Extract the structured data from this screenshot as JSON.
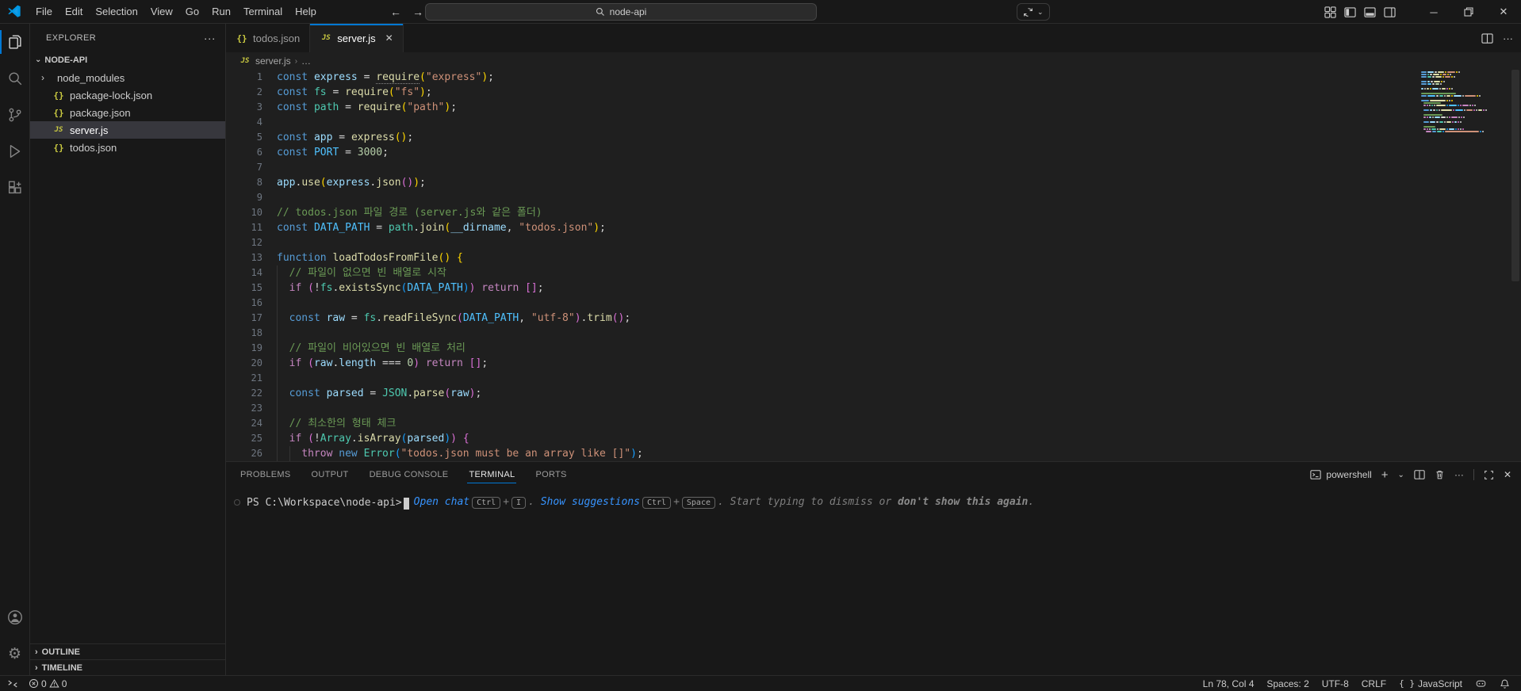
{
  "titlebar": {
    "menus": [
      "File",
      "Edit",
      "Selection",
      "View",
      "Go",
      "Run",
      "Terminal",
      "Help"
    ],
    "search_value": "node-api"
  },
  "explorer": {
    "header": "EXPLORER",
    "root": "NODE-API",
    "files": [
      {
        "name": "node_modules",
        "icon": "folder",
        "selected": false
      },
      {
        "name": "package-lock.json",
        "icon": "json",
        "selected": false
      },
      {
        "name": "package.json",
        "icon": "json",
        "selected": false
      },
      {
        "name": "server.js",
        "icon": "js",
        "selected": true
      },
      {
        "name": "todos.json",
        "icon": "json",
        "selected": false
      }
    ],
    "sections": [
      "OUTLINE",
      "TIMELINE"
    ]
  },
  "tabs": [
    {
      "label": "todos.json",
      "icon": "json",
      "active": false
    },
    {
      "label": "server.js",
      "icon": "js",
      "active": true
    }
  ],
  "breadcrumb": {
    "file": "server.js",
    "tail": "…"
  },
  "syntax_colors": {
    "kw": "#569CD6",
    "ctrl": "#C586C0",
    "var": "#9CDCFE",
    "cn": "#4FC1FF",
    "fn": "#DCDCAA",
    "fnh": "#DCDCAA",
    "cls": "#4EC9B0",
    "str": "#CE9178",
    "num": "#B5CEA8",
    "com": "#6A9955",
    "op": "#D4D4D4",
    "b1": "#FFD700",
    "b2": "#DA70D6",
    "b3": "#179FFF"
  },
  "editor": {
    "lines": [
      [
        [
          "kw",
          "const "
        ],
        [
          "var",
          "express"
        ],
        [
          "op",
          " = "
        ],
        [
          "fnh",
          "require"
        ],
        [
          "b1",
          "("
        ],
        [
          "str",
          "\"express\""
        ],
        [
          "b1",
          ")"
        ],
        [
          "op",
          ";"
        ]
      ],
      [
        [
          "kw",
          "const "
        ],
        [
          "cls",
          "fs"
        ],
        [
          "op",
          " = "
        ],
        [
          "fn",
          "require"
        ],
        [
          "b1",
          "("
        ],
        [
          "str",
          "\"fs\""
        ],
        [
          "b1",
          ")"
        ],
        [
          "op",
          ";"
        ]
      ],
      [
        [
          "kw",
          "const "
        ],
        [
          "cls",
          "path"
        ],
        [
          "op",
          " = "
        ],
        [
          "fn",
          "require"
        ],
        [
          "b1",
          "("
        ],
        [
          "str",
          "\"path\""
        ],
        [
          "b1",
          ")"
        ],
        [
          "op",
          ";"
        ]
      ],
      [],
      [
        [
          "kw",
          "const "
        ],
        [
          "var",
          "app"
        ],
        [
          "op",
          " = "
        ],
        [
          "fn",
          "express"
        ],
        [
          "b1",
          "()"
        ],
        [
          "op",
          ";"
        ]
      ],
      [
        [
          "kw",
          "const "
        ],
        [
          "cn",
          "PORT"
        ],
        [
          "op",
          " = "
        ],
        [
          "num",
          "3000"
        ],
        [
          "op",
          ";"
        ]
      ],
      [],
      [
        [
          "var",
          "app"
        ],
        [
          "op",
          "."
        ],
        [
          "fn",
          "use"
        ],
        [
          "b1",
          "("
        ],
        [
          "var",
          "express"
        ],
        [
          "op",
          "."
        ],
        [
          "fn",
          "json"
        ],
        [
          "b2",
          "()"
        ],
        [
          "b1",
          ")"
        ],
        [
          "op",
          ";"
        ]
      ],
      [],
      [
        [
          "com",
          "// todos.json 파일 경로 (server.js와 같은 폴더)"
        ]
      ],
      [
        [
          "kw",
          "const "
        ],
        [
          "cn",
          "DATA_PATH"
        ],
        [
          "op",
          " = "
        ],
        [
          "cls",
          "path"
        ],
        [
          "op",
          "."
        ],
        [
          "fn",
          "join"
        ],
        [
          "b1",
          "("
        ],
        [
          "var",
          "__dirname"
        ],
        [
          "op",
          ", "
        ],
        [
          "str",
          "\"todos.json\""
        ],
        [
          "b1",
          ")"
        ],
        [
          "op",
          ";"
        ]
      ],
      [],
      [
        [
          "kw",
          "function "
        ],
        [
          "fn",
          "loadTodosFromFile"
        ],
        [
          "b1",
          "()"
        ],
        [
          "op",
          " "
        ],
        [
          "b1",
          "{"
        ]
      ],
      [
        [
          "guide",
          "  "
        ],
        [
          "com",
          "// 파일이 없으면 빈 배열로 시작"
        ]
      ],
      [
        [
          "guide",
          "  "
        ],
        [
          "ctrl",
          "if "
        ],
        [
          "b2",
          "("
        ],
        [
          "op",
          "!"
        ],
        [
          "cls",
          "fs"
        ],
        [
          "op",
          "."
        ],
        [
          "fn",
          "existsSync"
        ],
        [
          "b3",
          "("
        ],
        [
          "cn",
          "DATA_PATH"
        ],
        [
          "b3",
          ")"
        ],
        [
          "b2",
          ")"
        ],
        [
          "ctrl",
          " return"
        ],
        [
          "op",
          " "
        ],
        [
          "b2",
          "[]"
        ],
        [
          "op",
          ";"
        ]
      ],
      [
        [
          "guide",
          "  "
        ]
      ],
      [
        [
          "guide",
          "  "
        ],
        [
          "kw",
          "const "
        ],
        [
          "var",
          "raw"
        ],
        [
          "op",
          " = "
        ],
        [
          "cls",
          "fs"
        ],
        [
          "op",
          "."
        ],
        [
          "fn",
          "readFileSync"
        ],
        [
          "b2",
          "("
        ],
        [
          "cn",
          "DATA_PATH"
        ],
        [
          "op",
          ", "
        ],
        [
          "str",
          "\"utf-8\""
        ],
        [
          "b2",
          ")"
        ],
        [
          "op",
          "."
        ],
        [
          "fn",
          "trim"
        ],
        [
          "b2",
          "()"
        ],
        [
          "op",
          ";"
        ]
      ],
      [
        [
          "guide",
          "  "
        ]
      ],
      [
        [
          "guide",
          "  "
        ],
        [
          "com",
          "// 파일이 비어있으면 빈 배열로 처리"
        ]
      ],
      [
        [
          "guide",
          "  "
        ],
        [
          "ctrl",
          "if "
        ],
        [
          "b2",
          "("
        ],
        [
          "var",
          "raw"
        ],
        [
          "op",
          "."
        ],
        [
          "var",
          "length"
        ],
        [
          "op",
          " === "
        ],
        [
          "num",
          "0"
        ],
        [
          "b2",
          ")"
        ],
        [
          "ctrl",
          " return"
        ],
        [
          "op",
          " "
        ],
        [
          "b2",
          "[]"
        ],
        [
          "op",
          ";"
        ]
      ],
      [
        [
          "guide",
          "  "
        ]
      ],
      [
        [
          "guide",
          "  "
        ],
        [
          "kw",
          "const "
        ],
        [
          "var",
          "parsed"
        ],
        [
          "op",
          " = "
        ],
        [
          "cls",
          "JSON"
        ],
        [
          "op",
          "."
        ],
        [
          "fn",
          "parse"
        ],
        [
          "b2",
          "("
        ],
        [
          "var",
          "raw"
        ],
        [
          "b2",
          ")"
        ],
        [
          "op",
          ";"
        ]
      ],
      [
        [
          "guide",
          "  "
        ]
      ],
      [
        [
          "guide",
          "  "
        ],
        [
          "com",
          "// 최소한의 형태 체크"
        ]
      ],
      [
        [
          "guide",
          "  "
        ],
        [
          "ctrl",
          "if "
        ],
        [
          "b2",
          "("
        ],
        [
          "op",
          "!"
        ],
        [
          "cls",
          "Array"
        ],
        [
          "op",
          "."
        ],
        [
          "fn",
          "isArray"
        ],
        [
          "b3",
          "("
        ],
        [
          "var",
          "parsed"
        ],
        [
          "b3",
          ")"
        ],
        [
          "b2",
          ")"
        ],
        [
          "op",
          " "
        ],
        [
          "b2",
          "{"
        ]
      ],
      [
        [
          "guide",
          "  "
        ],
        [
          "guide",
          "  "
        ],
        [
          "ctrl",
          "throw "
        ],
        [
          "kw",
          "new "
        ],
        [
          "cls",
          "Error"
        ],
        [
          "b3",
          "("
        ],
        [
          "str",
          "\"todos.json must be an array like []\""
        ],
        [
          "b3",
          ")"
        ],
        [
          "op",
          ";"
        ]
      ]
    ]
  },
  "panel": {
    "tabs": [
      {
        "label": "PROBLEMS",
        "active": false
      },
      {
        "label": "OUTPUT",
        "active": false
      },
      {
        "label": "DEBUG CONSOLE",
        "active": false
      },
      {
        "label": "TERMINAL",
        "active": true
      },
      {
        "label": "PORTS",
        "active": false
      }
    ],
    "shell": "powershell"
  },
  "terminal": {
    "prompt": "PS C:\\Workspace\\node-api>",
    "suggest": [
      {
        "t": "link",
        "x": "Open chat"
      },
      {
        "t": "key",
        "x": "Ctrl"
      },
      {
        "t": "plus",
        "x": "+"
      },
      {
        "t": "key",
        "x": "I"
      },
      {
        "t": "dim",
        "x": ". "
      },
      {
        "t": "link",
        "x": "Show suggestions"
      },
      {
        "t": "key",
        "x": "Ctrl"
      },
      {
        "t": "plus",
        "x": "+"
      },
      {
        "t": "key",
        "x": "Space"
      },
      {
        "t": "dim",
        "x": ". Start typing to dismiss or "
      },
      {
        "t": "dimb",
        "x": "don't show this again"
      },
      {
        "t": "dim",
        "x": "."
      }
    ]
  },
  "statusbar": {
    "errors": "0",
    "warnings": "0",
    "items": [
      "Ln 78, Col 4",
      "Spaces: 2",
      "UTF-8",
      "CRLF"
    ],
    "language": "JavaScript"
  },
  "colors": {
    "accent": "#0078d4",
    "editor_bg": "#1f1f1f",
    "shell_bg": "#181818"
  }
}
